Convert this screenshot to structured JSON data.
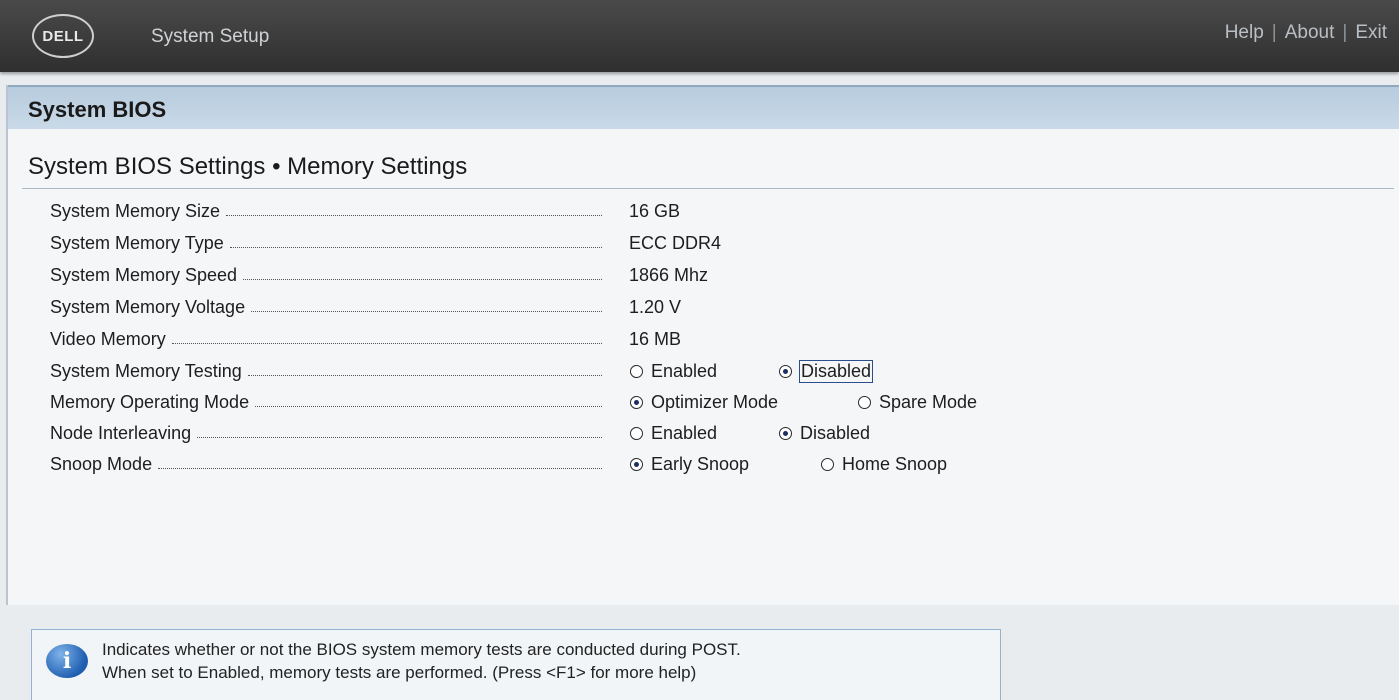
{
  "header": {
    "logo_text": "DELL",
    "app_title": "System Setup",
    "nav": [
      "Help",
      "About",
      "Exit"
    ]
  },
  "section": {
    "title": "System BIOS",
    "subtitle": "System BIOS Settings • Memory Settings"
  },
  "settings": {
    "memory_size": {
      "label": "System Memory Size",
      "value": "16 GB"
    },
    "memory_type": {
      "label": "System Memory Type",
      "value": "ECC DDR4"
    },
    "memory_speed": {
      "label": "System Memory Speed",
      "value": "1866 Mhz"
    },
    "memory_voltage": {
      "label": "System Memory Voltage",
      "value": "1.20 V"
    },
    "video_memory": {
      "label": "Video Memory",
      "value": "16 MB"
    },
    "memory_testing": {
      "label": "System Memory Testing",
      "options": [
        "Enabled",
        "Disabled"
      ],
      "selected": "Disabled"
    },
    "operating_mode": {
      "label": "Memory Operating Mode",
      "options": [
        "Optimizer Mode",
        "Spare Mode"
      ],
      "selected": "Optimizer Mode"
    },
    "node_interleaving": {
      "label": "Node Interleaving",
      "options": [
        "Enabled",
        "Disabled"
      ],
      "selected": "Disabled"
    },
    "snoop_mode": {
      "label": "Snoop Mode",
      "options": [
        "Early Snoop",
        "Home Snoop"
      ],
      "selected": "Early Snoop"
    }
  },
  "help": {
    "icon": "info-icon",
    "line1": "Indicates whether or not the BIOS system memory tests are conducted during POST.",
    "line2": "When set to Enabled, memory tests are performed. (Press <F1> for more help)"
  },
  "colors": {
    "header_bg": "#3a3a3a",
    "section_bar": "#b7ccdf",
    "panel_bg": "#f4f6f8",
    "radio_fill": "#1c2f62"
  }
}
